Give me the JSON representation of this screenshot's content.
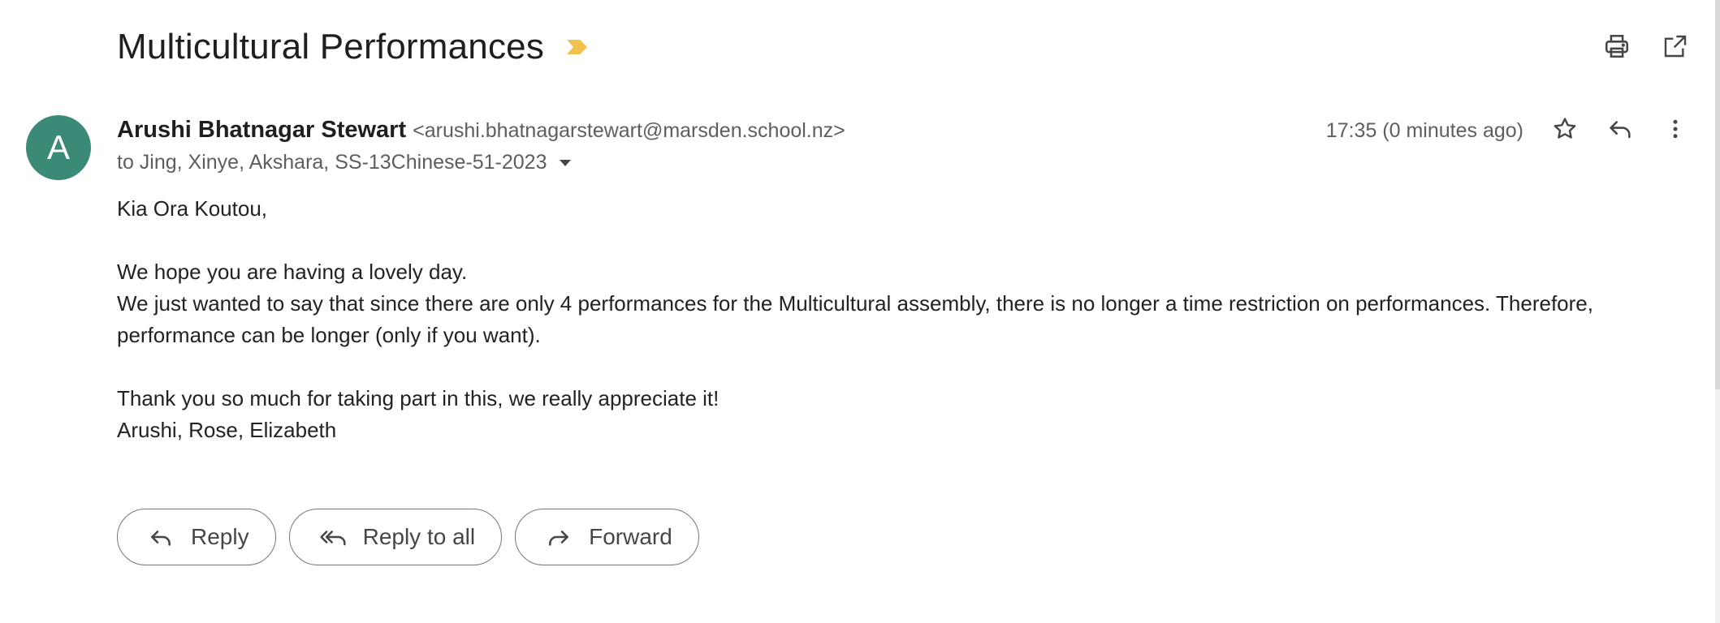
{
  "subject": "Multicultural Performances",
  "importance_color": "#f2c04d",
  "toolbar": {
    "print_icon": "print-icon",
    "open_new_window_icon": "open-in-new-icon"
  },
  "message": {
    "avatar_letter": "A",
    "avatar_color": "#3b8a78",
    "sender_name": "Arushi Bhatnagar Stewart",
    "sender_email": "<arushi.bhatnagarstewart@marsden.school.nz>",
    "recipients": "to Jing, Xinye, Akshara, SS-13Chinese-51-2023",
    "timestamp": "17:35 (0 minutes ago)",
    "icons": [
      "star-icon",
      "reply-icon",
      "more-vert-icon"
    ],
    "body": {
      "greeting": "Kia Ora Koutou,",
      "line1": "We hope you are having a lovely day.",
      "line2": "We just wanted to say that since there are only 4 performances for the Multicultural assembly, there is no longer a time restriction on performances. Therefore, performance can be longer (only if you want).",
      "line3": "Thank you so much for taking part in this, we really appreciate it!",
      "signature": "Arushi, Rose, Elizabeth"
    }
  },
  "actions": {
    "reply_label": "Reply",
    "reply_all_label": "Reply to all",
    "forward_label": "Forward"
  }
}
